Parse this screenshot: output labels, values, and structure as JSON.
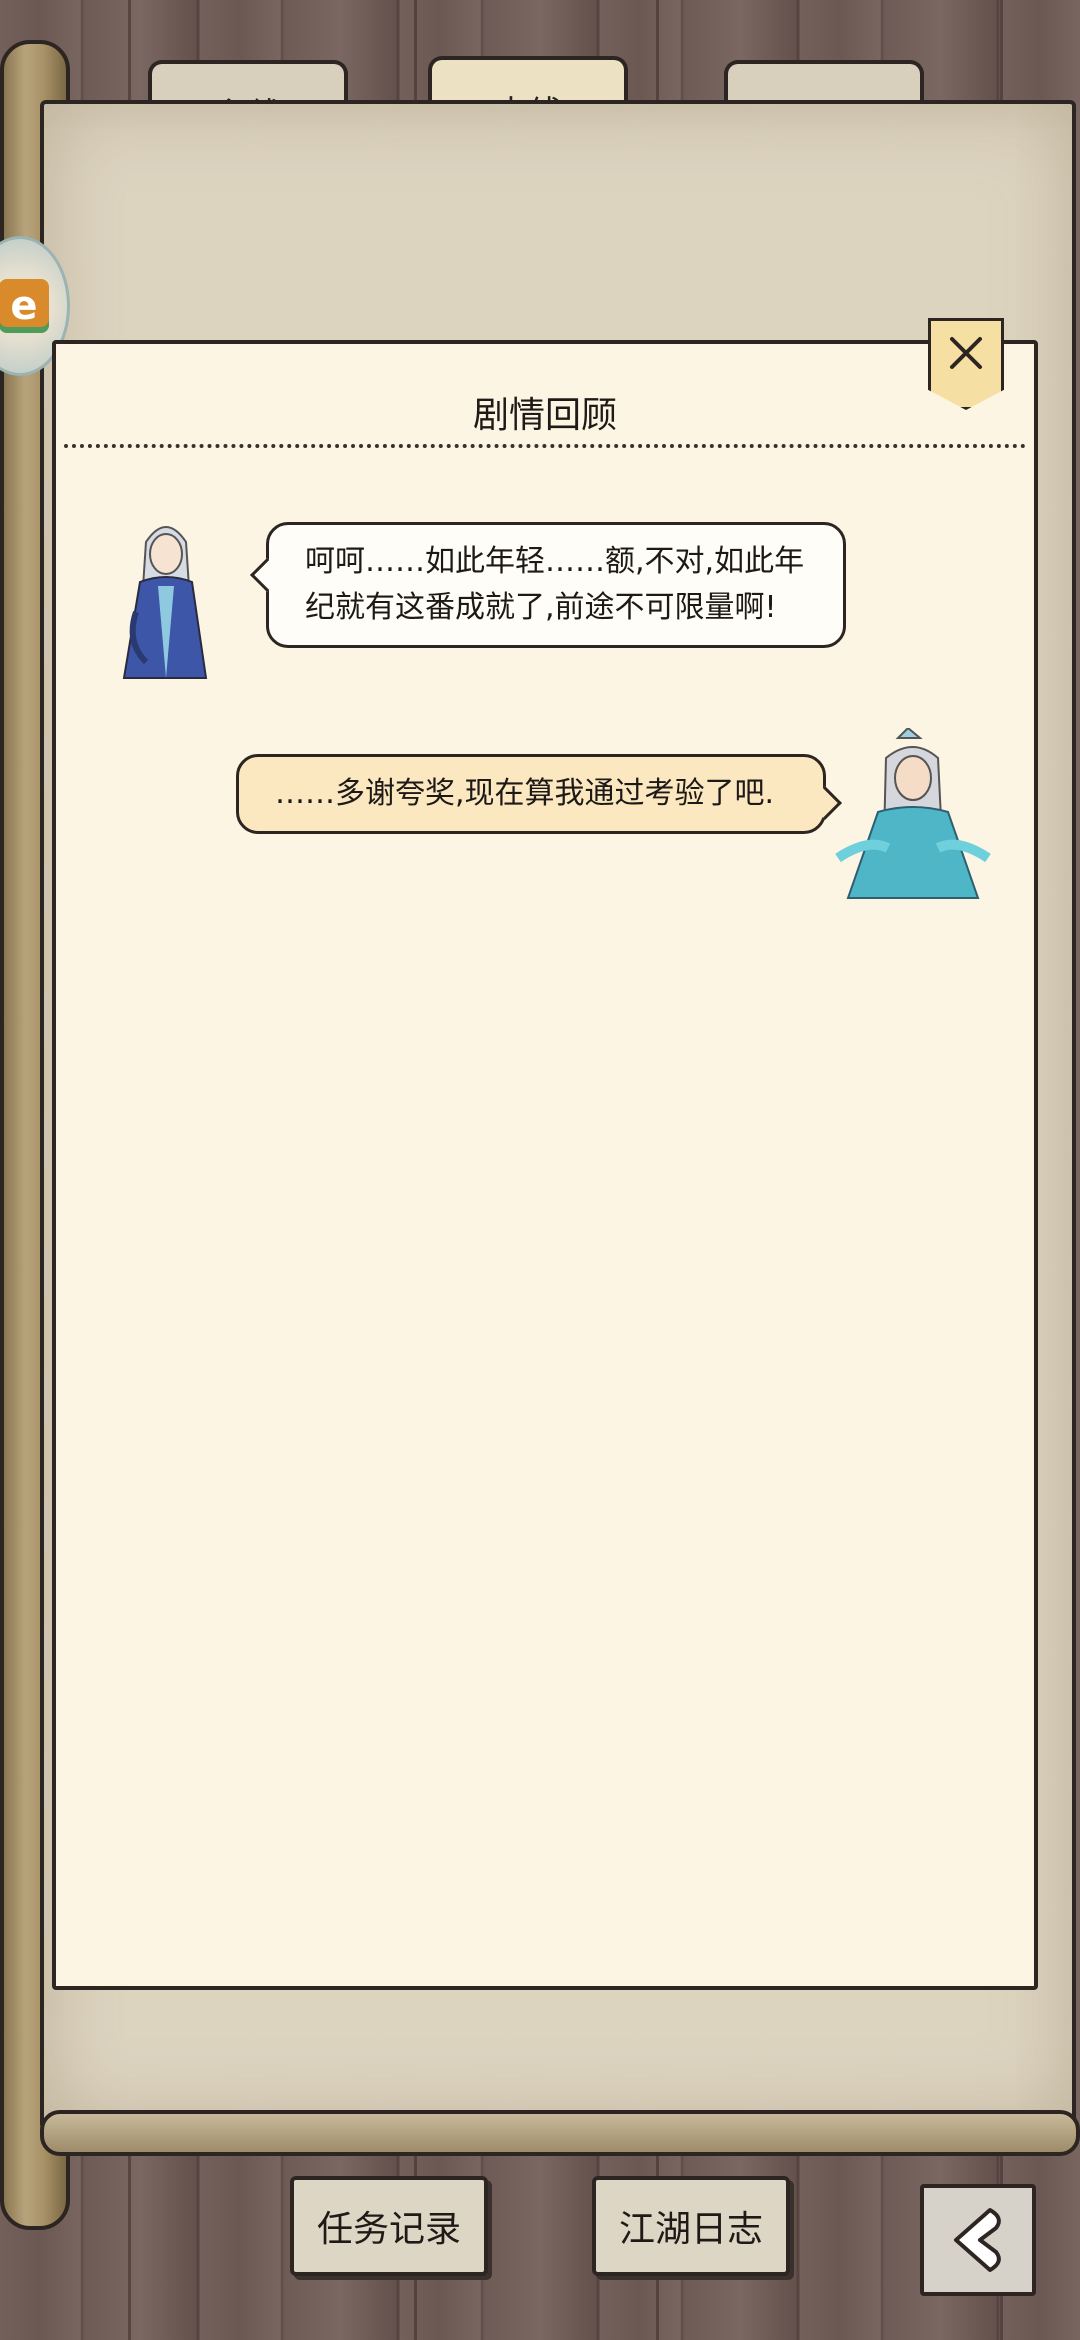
{
  "tabs": [
    {
      "label": "主线",
      "active": false
    },
    {
      "label": "支线",
      "active": true
    },
    {
      "label": "环",
      "active": false
    }
  ],
  "side_button": {
    "icon": "app-badge-icon"
  },
  "dialog": {
    "title": "剧情回顾",
    "close_icon": "close-icon",
    "messages": [
      {
        "speaker_side": "left",
        "text": "呵呵……如此年轻……额,不对,如此年纪就有这番成就了,前途不可限量啊!"
      },
      {
        "speaker_side": "right",
        "text": "……多谢夸奖,现在算我通过考验了吧."
      }
    ]
  },
  "bottom_bar": {
    "tasks_label": "任务记录",
    "journal_label": "江湖日志",
    "back_icon": "back-arrow-icon"
  },
  "colors": {
    "panel_bg": "#fcf5e4",
    "scroll_bg": "#ddd4c0",
    "close_bg": "#f6dfa2",
    "right_bubble": "#fbe8c0"
  }
}
